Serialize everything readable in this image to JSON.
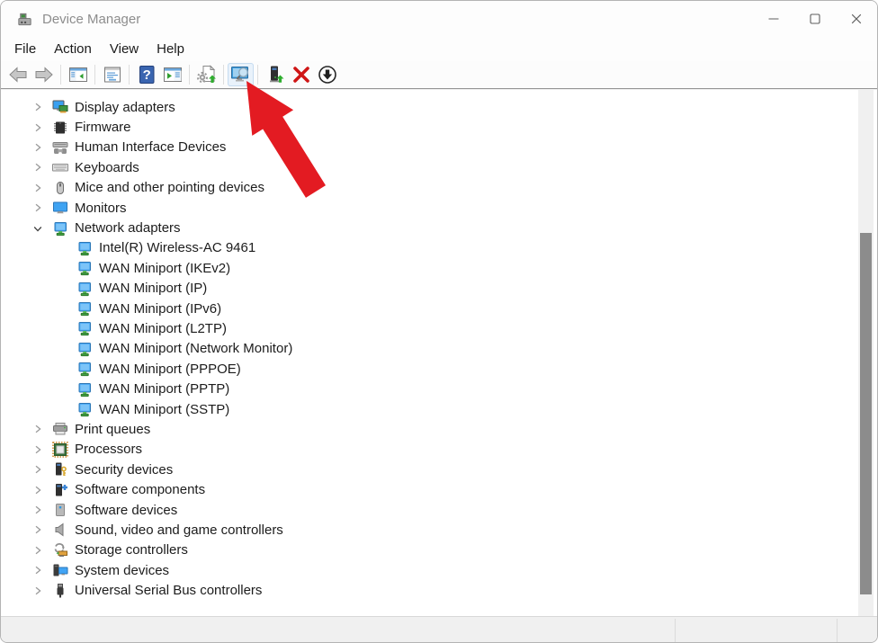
{
  "window": {
    "title": "Device Manager",
    "icon": "device-manager-icon",
    "controls": [
      {
        "name": "minimize-button",
        "icon": "minimize-icon"
      },
      {
        "name": "maximize-button",
        "icon": "maximize-icon"
      },
      {
        "name": "close-button",
        "icon": "close-icon"
      }
    ]
  },
  "menu": {
    "items": [
      {
        "label": "File"
      },
      {
        "label": "Action"
      },
      {
        "label": "View"
      },
      {
        "label": "Help"
      }
    ]
  },
  "toolbar": {
    "buttons": [
      {
        "name": "back-button",
        "icon": "back-arrow-icon"
      },
      {
        "name": "forward-button",
        "icon": "forward-arrow-icon"
      },
      {
        "name": "show-hide-console-tree-button",
        "icon": "console-tree-icon"
      },
      {
        "name": "properties-button",
        "icon": "properties-icon"
      },
      {
        "name": "help-button",
        "icon": "help-icon"
      },
      {
        "name": "show-action-pane-button",
        "icon": "action-pane-icon"
      },
      {
        "name": "update-driver-button",
        "icon": "update-driver-icon"
      },
      {
        "name": "scan-hardware-changes-button",
        "icon": "scan-hardware-icon",
        "highlighted": true
      },
      {
        "name": "add-drivers-button",
        "icon": "add-drivers-icon"
      },
      {
        "name": "uninstall-device-button",
        "icon": "uninstall-icon"
      },
      {
        "name": "disable-device-button",
        "icon": "disable-icon"
      }
    ]
  },
  "annotation": {
    "type": "red-arrow",
    "color": "#e31b22",
    "points_to": "scan-hardware-changes-button"
  },
  "tree": {
    "items": [
      {
        "label": "Display adapters",
        "icon": "display-adapter-icon",
        "expanded": false
      },
      {
        "label": "Firmware",
        "icon": "firmware-icon",
        "expanded": false
      },
      {
        "label": "Human Interface Devices",
        "icon": "hid-icon",
        "expanded": false
      },
      {
        "label": "Keyboards",
        "icon": "keyboard-icon",
        "expanded": false
      },
      {
        "label": "Mice and other pointing devices",
        "icon": "mouse-icon",
        "expanded": false
      },
      {
        "label": "Monitors",
        "icon": "monitor-icon",
        "expanded": false
      },
      {
        "label": "Network adapters",
        "icon": "network-adapter-icon",
        "expanded": true,
        "children": [
          {
            "label": "Intel(R) Wireless-AC 9461",
            "icon": "network-adapter-icon"
          },
          {
            "label": "WAN Miniport (IKEv2)",
            "icon": "network-adapter-icon"
          },
          {
            "label": "WAN Miniport (IP)",
            "icon": "network-adapter-icon"
          },
          {
            "label": "WAN Miniport (IPv6)",
            "icon": "network-adapter-icon"
          },
          {
            "label": "WAN Miniport (L2TP)",
            "icon": "network-adapter-icon"
          },
          {
            "label": "WAN Miniport (Network Monitor)",
            "icon": "network-adapter-icon"
          },
          {
            "label": "WAN Miniport (PPPOE)",
            "icon": "network-adapter-icon"
          },
          {
            "label": "WAN Miniport (PPTP)",
            "icon": "network-adapter-icon"
          },
          {
            "label": "WAN Miniport (SSTP)",
            "icon": "network-adapter-icon"
          }
        ]
      },
      {
        "label": "Print queues",
        "icon": "printer-icon",
        "expanded": false
      },
      {
        "label": "Processors",
        "icon": "processor-icon",
        "expanded": false
      },
      {
        "label": "Security devices",
        "icon": "security-device-icon",
        "expanded": false
      },
      {
        "label": "Software components",
        "icon": "software-component-icon",
        "expanded": false
      },
      {
        "label": "Software devices",
        "icon": "software-device-icon",
        "expanded": false
      },
      {
        "label": "Sound, video and game controllers",
        "icon": "sound-icon",
        "expanded": false
      },
      {
        "label": "Storage controllers",
        "icon": "storage-controller-icon",
        "expanded": false
      },
      {
        "label": "System devices",
        "icon": "system-device-icon",
        "expanded": false
      },
      {
        "label": "Universal Serial Bus controllers",
        "icon": "usb-icon",
        "expanded": false
      }
    ]
  },
  "statusbar": {
    "text": ""
  }
}
